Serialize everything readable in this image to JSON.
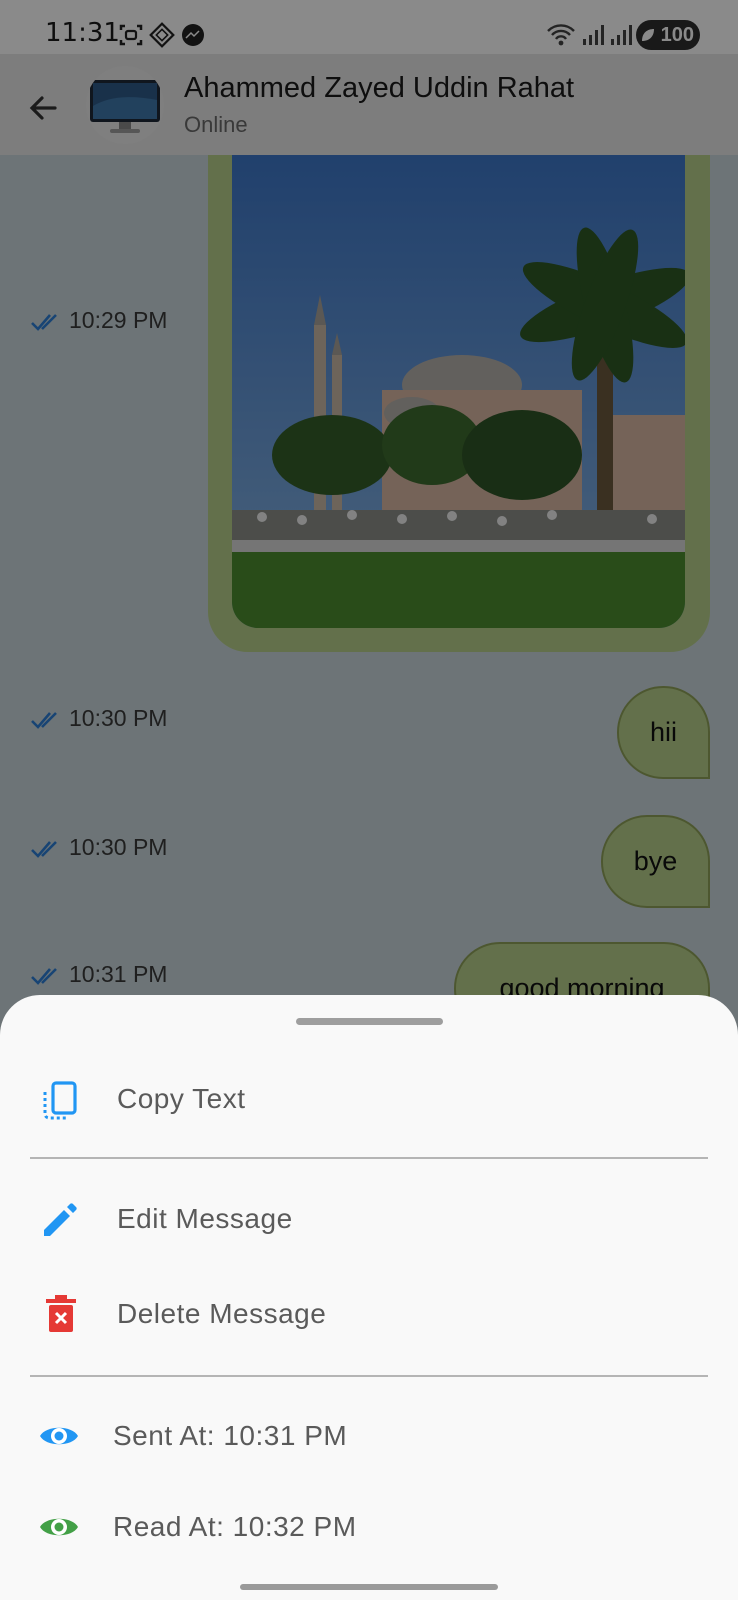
{
  "status_bar": {
    "time": "11:31",
    "battery": "100",
    "icons": [
      "screenshot-icon",
      "app-icon",
      "messenger-icon",
      "wifi-icon",
      "signal-icon",
      "signal-icon-2"
    ]
  },
  "header": {
    "contact_name": "Ahammed Zayed Uddin Rahat",
    "status": "Online"
  },
  "messages": [
    {
      "type": "image",
      "time": "10:29 PM",
      "read": true
    },
    {
      "type": "text",
      "text": "hii",
      "time": "10:30 PM",
      "read": true
    },
    {
      "type": "text",
      "text": "bye",
      "time": "10:30 PM",
      "read": true
    },
    {
      "type": "text",
      "text": "good morning",
      "time": "10:31 PM",
      "read": true
    }
  ],
  "sheet": {
    "copy_label": "Copy Text",
    "edit_label": "Edit Message",
    "delete_label": "Delete Message",
    "sent_label": "Sent At: 10:31 PM",
    "read_label": "Read At: 10:32 PM"
  },
  "colors": {
    "bubble": "#b8d08b",
    "tick_blue": "#2d7fd6",
    "icon_blue": "#2196f3",
    "icon_red": "#e53935",
    "icon_green": "#43a047"
  }
}
